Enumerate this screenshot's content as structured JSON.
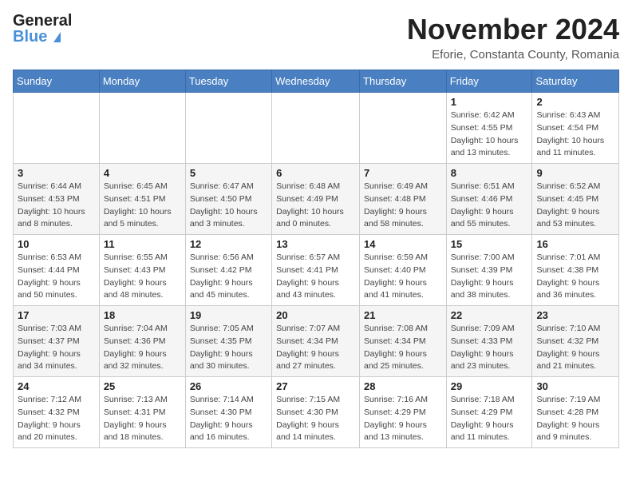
{
  "logo": {
    "general": "General",
    "blue": "Blue"
  },
  "header": {
    "month": "November 2024",
    "location": "Eforie, Constanta County, Romania"
  },
  "days_of_week": [
    "Sunday",
    "Monday",
    "Tuesday",
    "Wednesday",
    "Thursday",
    "Friday",
    "Saturday"
  ],
  "weeks": [
    [
      {
        "day": "",
        "info": ""
      },
      {
        "day": "",
        "info": ""
      },
      {
        "day": "",
        "info": ""
      },
      {
        "day": "",
        "info": ""
      },
      {
        "day": "",
        "info": ""
      },
      {
        "day": "1",
        "info": "Sunrise: 6:42 AM\nSunset: 4:55 PM\nDaylight: 10 hours and 13 minutes."
      },
      {
        "day": "2",
        "info": "Sunrise: 6:43 AM\nSunset: 4:54 PM\nDaylight: 10 hours and 11 minutes."
      }
    ],
    [
      {
        "day": "3",
        "info": "Sunrise: 6:44 AM\nSunset: 4:53 PM\nDaylight: 10 hours and 8 minutes."
      },
      {
        "day": "4",
        "info": "Sunrise: 6:45 AM\nSunset: 4:51 PM\nDaylight: 10 hours and 5 minutes."
      },
      {
        "day": "5",
        "info": "Sunrise: 6:47 AM\nSunset: 4:50 PM\nDaylight: 10 hours and 3 minutes."
      },
      {
        "day": "6",
        "info": "Sunrise: 6:48 AM\nSunset: 4:49 PM\nDaylight: 10 hours and 0 minutes."
      },
      {
        "day": "7",
        "info": "Sunrise: 6:49 AM\nSunset: 4:48 PM\nDaylight: 9 hours and 58 minutes."
      },
      {
        "day": "8",
        "info": "Sunrise: 6:51 AM\nSunset: 4:46 PM\nDaylight: 9 hours and 55 minutes."
      },
      {
        "day": "9",
        "info": "Sunrise: 6:52 AM\nSunset: 4:45 PM\nDaylight: 9 hours and 53 minutes."
      }
    ],
    [
      {
        "day": "10",
        "info": "Sunrise: 6:53 AM\nSunset: 4:44 PM\nDaylight: 9 hours and 50 minutes."
      },
      {
        "day": "11",
        "info": "Sunrise: 6:55 AM\nSunset: 4:43 PM\nDaylight: 9 hours and 48 minutes."
      },
      {
        "day": "12",
        "info": "Sunrise: 6:56 AM\nSunset: 4:42 PM\nDaylight: 9 hours and 45 minutes."
      },
      {
        "day": "13",
        "info": "Sunrise: 6:57 AM\nSunset: 4:41 PM\nDaylight: 9 hours and 43 minutes."
      },
      {
        "day": "14",
        "info": "Sunrise: 6:59 AM\nSunset: 4:40 PM\nDaylight: 9 hours and 41 minutes."
      },
      {
        "day": "15",
        "info": "Sunrise: 7:00 AM\nSunset: 4:39 PM\nDaylight: 9 hours and 38 minutes."
      },
      {
        "day": "16",
        "info": "Sunrise: 7:01 AM\nSunset: 4:38 PM\nDaylight: 9 hours and 36 minutes."
      }
    ],
    [
      {
        "day": "17",
        "info": "Sunrise: 7:03 AM\nSunset: 4:37 PM\nDaylight: 9 hours and 34 minutes."
      },
      {
        "day": "18",
        "info": "Sunrise: 7:04 AM\nSunset: 4:36 PM\nDaylight: 9 hours and 32 minutes."
      },
      {
        "day": "19",
        "info": "Sunrise: 7:05 AM\nSunset: 4:35 PM\nDaylight: 9 hours and 30 minutes."
      },
      {
        "day": "20",
        "info": "Sunrise: 7:07 AM\nSunset: 4:34 PM\nDaylight: 9 hours and 27 minutes."
      },
      {
        "day": "21",
        "info": "Sunrise: 7:08 AM\nSunset: 4:34 PM\nDaylight: 9 hours and 25 minutes."
      },
      {
        "day": "22",
        "info": "Sunrise: 7:09 AM\nSunset: 4:33 PM\nDaylight: 9 hours and 23 minutes."
      },
      {
        "day": "23",
        "info": "Sunrise: 7:10 AM\nSunset: 4:32 PM\nDaylight: 9 hours and 21 minutes."
      }
    ],
    [
      {
        "day": "24",
        "info": "Sunrise: 7:12 AM\nSunset: 4:32 PM\nDaylight: 9 hours and 20 minutes."
      },
      {
        "day": "25",
        "info": "Sunrise: 7:13 AM\nSunset: 4:31 PM\nDaylight: 9 hours and 18 minutes."
      },
      {
        "day": "26",
        "info": "Sunrise: 7:14 AM\nSunset: 4:30 PM\nDaylight: 9 hours and 16 minutes."
      },
      {
        "day": "27",
        "info": "Sunrise: 7:15 AM\nSunset: 4:30 PM\nDaylight: 9 hours and 14 minutes."
      },
      {
        "day": "28",
        "info": "Sunrise: 7:16 AM\nSunset: 4:29 PM\nDaylight: 9 hours and 13 minutes."
      },
      {
        "day": "29",
        "info": "Sunrise: 7:18 AM\nSunset: 4:29 PM\nDaylight: 9 hours and 11 minutes."
      },
      {
        "day": "30",
        "info": "Sunrise: 7:19 AM\nSunset: 4:28 PM\nDaylight: 9 hours and 9 minutes."
      }
    ]
  ]
}
